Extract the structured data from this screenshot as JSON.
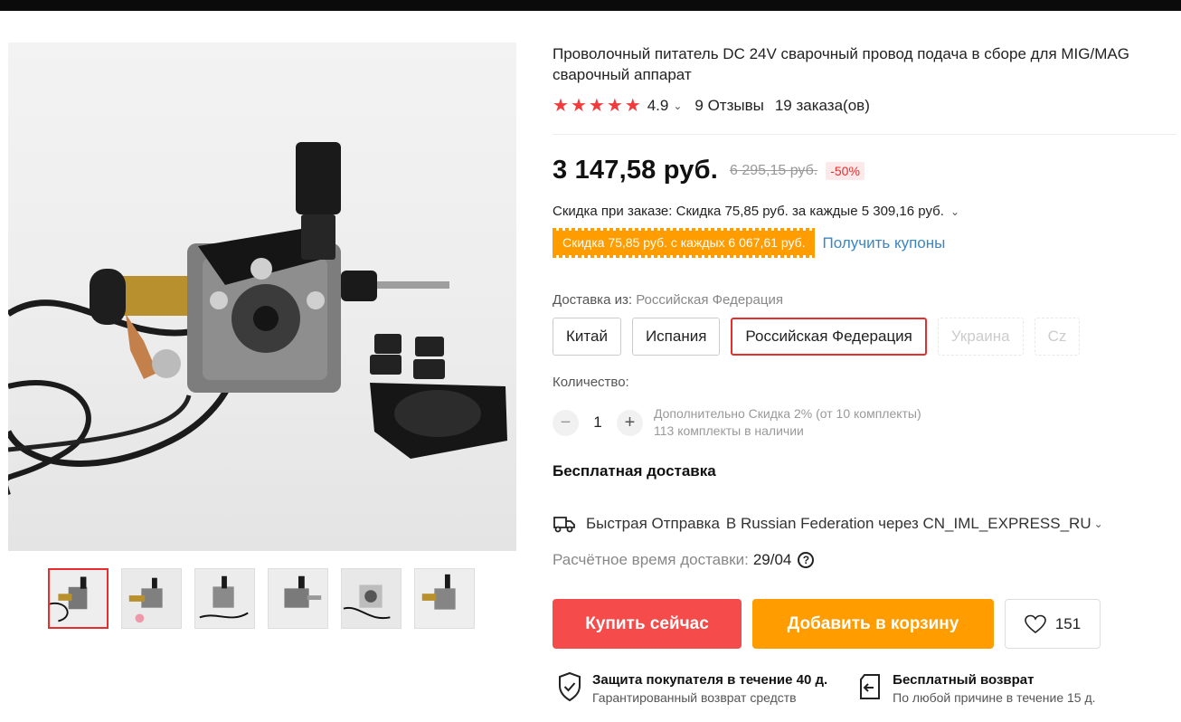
{
  "product": {
    "title": "Проволочный питатель DC 24V сварочный провод подача в сборе для MIG/MAG сварочный аппарат",
    "rating": "4.9",
    "reviews": "9 Отзывы",
    "orders": "19 заказа(ов)",
    "price": "3 147,58 руб.",
    "old_price": "6 295,15 руб.",
    "discount": "-50%",
    "order_discount": "Скидка при заказе: Скидка 75,85 руб. за каждые 5 309,16 руб.",
    "coupon_badge": "Скидка 75,85 руб. с каждых 6 067,61 руб.",
    "coupon_link": "Получить купоны"
  },
  "shipping": {
    "from_label": "Доставка из:",
    "from_value": "Российская Федерация",
    "options": [
      {
        "label": "Китай",
        "state": "normal"
      },
      {
        "label": "Испания",
        "state": "normal"
      },
      {
        "label": "Российская Федерация",
        "state": "selected"
      },
      {
        "label": "Украина",
        "state": "disabled"
      },
      {
        "label": "Cz",
        "state": "disabled"
      }
    ],
    "free": "Бесплатная доставка",
    "fast": "Быстрая Отправка",
    "via": "В Russian Federation через CN_IML_EXPRESS_RU",
    "eta_label": "Расчётное время доставки:",
    "eta_date": "29/04",
    "help": "?"
  },
  "quantity": {
    "label": "Количество:",
    "value": "1",
    "minus": "−",
    "plus": "+",
    "extra_discount": "Дополнительно Скидка 2% (от 10 комплекты)",
    "stock": "113 комплекты в наличии"
  },
  "actions": {
    "buy": "Купить сейчас",
    "cart": "Добавить в корзину",
    "wishlist_count": "151"
  },
  "guarantees": [
    {
      "title": "Защита покупателя в течение 40 д.",
      "subtitle": "Гарантированный возврат средств",
      "icon": "shield-check-icon"
    },
    {
      "title": "Бесплатный возврат",
      "subtitle": "По любой причине в течение 15 д.",
      "icon": "return-icon"
    }
  ],
  "gallery": {
    "thumbnail_count": 6,
    "active_index": 0
  },
  "colors": {
    "accent_red": "#f64b4b",
    "accent_orange": "#ff9c00",
    "star": "#f23c3c",
    "link": "#3a86c4"
  }
}
